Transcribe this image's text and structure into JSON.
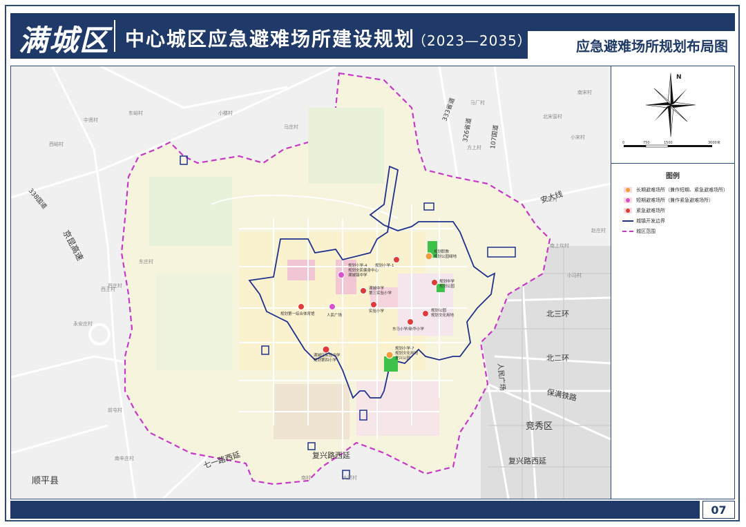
{
  "header": {
    "brand": "满城区",
    "title": "中心城区应急避难场所建设规划",
    "years": "（2023—2035）",
    "subtitle": "应急避难场所规划布局图"
  },
  "compass": {
    "north_label": "N"
  },
  "scale_bar": {
    "labels": [
      "0",
      "750",
      "1500",
      "3000米"
    ]
  },
  "legend": {
    "title": "图例",
    "items": [
      {
        "label": "长期避难场所（兼作短期、紧急避难场所）",
        "color": "#f39c3c"
      },
      {
        "label": "短期避难场所（兼作紧急避难场所）",
        "color": "#d94fd0"
      },
      {
        "label": "紧急避难场所",
        "color": "#e03a3a"
      },
      {
        "label": "城镇开发边界",
        "color": "#1d2f8c"
      },
      {
        "label": "城区范围",
        "color": "#c638c8"
      }
    ]
  },
  "map": {
    "districts": [
      "竞秀区",
      "顺平县"
    ],
    "roads": [
      "复兴路西延",
      "复兴路西延",
      "北三环",
      "北二环",
      "保满铁路",
      "安大线",
      "七一路西延",
      "西三环",
      "人民广场",
      "338国道",
      "333省道",
      "326省道",
      "107国道",
      "京昆高速"
    ],
    "villages": [
      "中贤村",
      "西峪村",
      "东峪村",
      "小楼村",
      "马庄村",
      "西庄村",
      "北宋营村",
      "南宋村",
      "小宋村",
      "方上村",
      "马厂村",
      "东庄村",
      "西王村",
      "永安庄村",
      "前屯村",
      "南上坎村",
      "小马村",
      "南辛庄村",
      "大贾村",
      "南村",
      "王庄村",
      "赵庄村"
    ],
    "sites": [
      {
        "label": "规划小学-4\n规划全民健身中心\n满城镇中学",
        "type": "short"
      },
      {
        "label": "规划小学-1",
        "type": "emergency"
      },
      {
        "label": "规划职教\n规划公园绿地",
        "type": "long"
      },
      {
        "label": "规划中学\n规划公园",
        "type": "emergency"
      },
      {
        "label": "满城中学\n第三实验小学",
        "type": "emergency"
      },
      {
        "label": "实验小学",
        "type": "emergency"
      },
      {
        "label": "人民广场",
        "type": "short"
      },
      {
        "label": "规划第一综合体育馆",
        "type": "emergency"
      },
      {
        "label": "规划公园\n规划文化用地",
        "type": "emergency"
      },
      {
        "label": "东马小学/新华小学",
        "type": "emergency"
      },
      {
        "label": "满城区实验中学\n规划第四小学",
        "type": "emergency"
      },
      {
        "label": "规划小学-7\n规划文化用地\n复兴公园",
        "type": "long"
      }
    ]
  },
  "page": {
    "number": "07"
  }
}
